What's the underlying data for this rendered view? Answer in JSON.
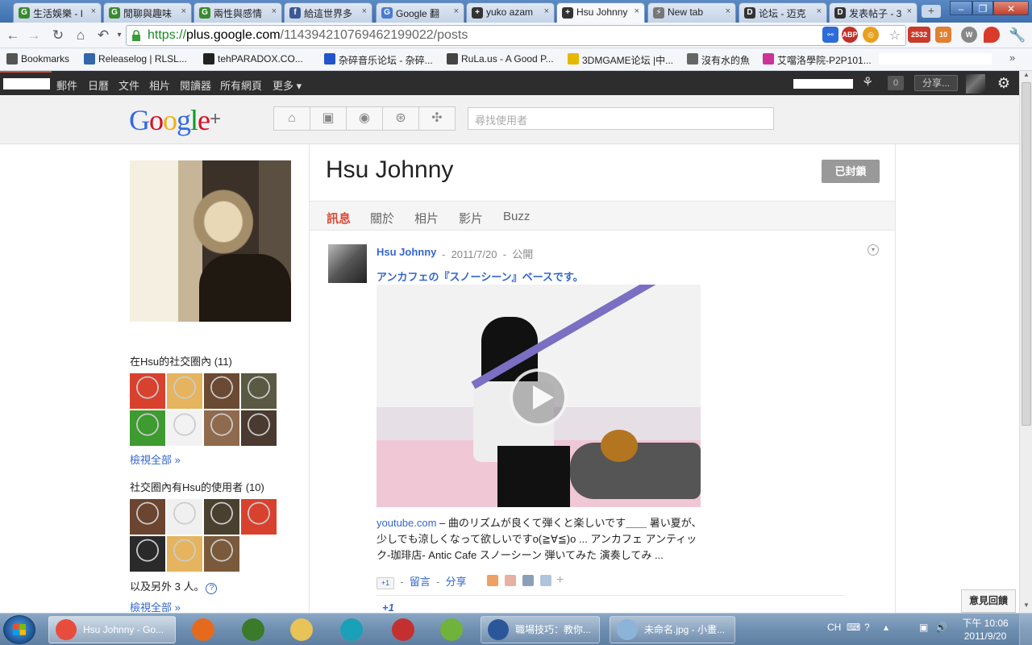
{
  "browser": {
    "tabs": [
      {
        "label": "生活娛樂 - I",
        "color": "#3a8a2e",
        "glyph": "G"
      },
      {
        "label": "閒聊與趣味",
        "color": "#3a8a2e",
        "glyph": "G"
      },
      {
        "label": "兩性與感情",
        "color": "#3a8a2e",
        "glyph": "G"
      },
      {
        "label": "給這世界多",
        "color": "#3b5998",
        "glyph": "f"
      },
      {
        "label": "Google 翻",
        "color": "#4a7bd0",
        "glyph": "G"
      },
      {
        "label": "yuko azam",
        "color": "#333333",
        "glyph": "+"
      },
      {
        "label": "Hsu Johnny",
        "color": "#333333",
        "glyph": "+"
      },
      {
        "label": "New tab",
        "color": "#777777",
        "glyph": "⚡"
      },
      {
        "label": "论坛 - 迈克",
        "color": "#333333",
        "glyph": "D"
      },
      {
        "label": "发表帖子 - 3",
        "color": "#333333",
        "glyph": "D"
      }
    ],
    "url_scheme": "https://",
    "url_host": "plus.google.com",
    "url_path": "/114394210769462199022/posts",
    "extension_badges": {
      "mail": "2532",
      "rss": "10"
    },
    "bookmarks": [
      {
        "label": "Bookmarks",
        "color": "#555555"
      },
      {
        "label": "Releaselog | RLSL...",
        "color": "#3366aa"
      },
      {
        "label": "tehPARADOX.CO...",
        "color": "#222222"
      },
      {
        "label": "杂碎音乐论坛 - 杂碎...",
        "color": "#2255cc"
      },
      {
        "label": "RuLa.us - A Good P...",
        "color": "#444444"
      },
      {
        "label": "3DMGAME论坛 |中...",
        "color": "#e6b800"
      },
      {
        "label": "沒有水的魚",
        "color": "#666666"
      },
      {
        "label": "艾噹洛學院-P2P101...",
        "color": "#cc3399"
      }
    ]
  },
  "gbar": {
    "links": [
      "郵件",
      "日曆",
      "文件",
      "相片",
      "閱讀器",
      "所有網頁",
      "更多 ▾"
    ],
    "notif_count": "0",
    "share_label": "分享..."
  },
  "gplus": {
    "logo_text": "Google",
    "logo_plus": "+",
    "logo_colors": [
      "#3369e8",
      "#d50f25",
      "#eeb211",
      "#3369e8",
      "#009925",
      "#d50f25"
    ],
    "nav_icons": [
      "home-icon",
      "photos-icon",
      "profile-icon",
      "circles-icon",
      "games-icon"
    ],
    "search_placeholder": "尋找使用者"
  },
  "profile": {
    "name": "Hsu Johnny",
    "blocked_label": "已封鎖",
    "tabs": [
      "訊息",
      "關於",
      "相片",
      "影片",
      "Buzz"
    ],
    "in_circles_title": "在Hsu的社交圈內 (11)",
    "have_in_circles_title": "社交圈內有Hsu的使用者 (10)",
    "view_all": "檢視全部 »",
    "others_text": "以及另外 3 人。",
    "help_glyph": "?"
  },
  "post": {
    "author": "Hsu Johnny",
    "sep": "-",
    "date": "2011/7/20",
    "visibility": "公開",
    "link_title": "アンカフェの『スノーシーン』ベースです。",
    "source": "youtube.com",
    "snippet": " – 曲のリズムが良くて弾くと楽しいです＿＿ 暑い夏が、少しでも涼しくなって欲しいですo(≧∀≦)o ... アンカフェ アンティック-珈琲店- Antic Cafe スノーシーン 弾いてみた 演奏してみ ...",
    "plus_one_label": "+1",
    "comment_label": "留言",
    "share_label": "分享",
    "plus_one_count": "+1"
  },
  "feedback_label": "意見回饋",
  "taskbar": {
    "items": [
      {
        "label": "Hsu Johnny - Go...",
        "color": "#e84c3d"
      },
      {
        "label": "職場技巧：教你...",
        "color": "#2b579a"
      },
      {
        "label": "未命名.jpg - 小畫...",
        "color": "#8cb4d8"
      }
    ],
    "pins": [
      {
        "name": "firefox-icon",
        "color": "#e66a1e"
      },
      {
        "name": "app-icon",
        "color": "#3b7a2a"
      },
      {
        "name": "explorer-icon",
        "color": "#e8c358"
      },
      {
        "name": "eye-icon",
        "color": "#1aa0b8"
      },
      {
        "name": "power-icon",
        "color": "#c43030"
      },
      {
        "name": "frog-icon",
        "color": "#6fb33a"
      }
    ],
    "lang": "CH",
    "time": "下午 10:06",
    "date": "2011/9/20"
  }
}
